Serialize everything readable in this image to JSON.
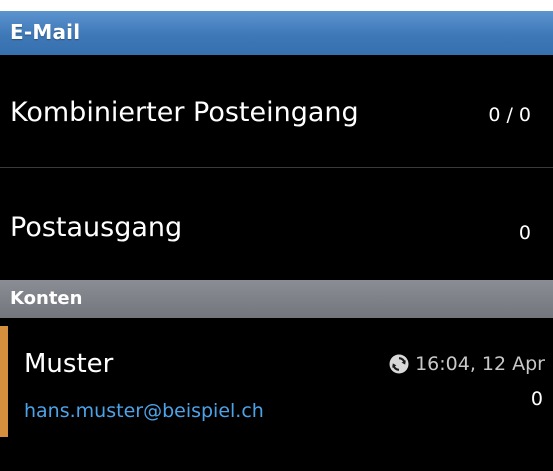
{
  "app": {
    "title": "E-Mail"
  },
  "folders": [
    {
      "label": "Kombinierter Posteingang",
      "count": "0 / 0"
    },
    {
      "label": "Postausgang",
      "count": "0"
    }
  ],
  "accounts_section": {
    "header": "Konten"
  },
  "accounts": [
    {
      "name": "Muster",
      "email": "hans.muster@beispiel.ch",
      "last_sync": "16:04, 12 Apr",
      "count": "0",
      "sync_icon": "sync-icon",
      "accent_color": "#d58f3d"
    }
  ],
  "colors": {
    "titlebar": "#3f78b7",
    "background": "#000000",
    "section_header": "#7d8187",
    "email_link": "#4da3e8"
  }
}
